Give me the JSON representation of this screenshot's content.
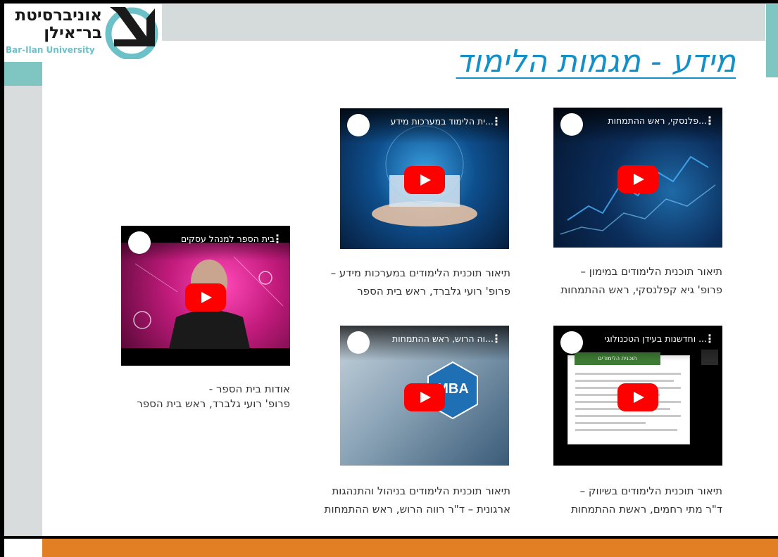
{
  "logo": {
    "hebrew_line1": "אוניברסיטת",
    "hebrew_line2": "בר־אילן",
    "english": "Bar-Ilan University"
  },
  "title": "מידע  -  מגמות הלימוד",
  "colors": {
    "title": "#1490c9",
    "top_bar": "#d5dadb",
    "teal": "#7fc6c3",
    "bottom_bar": "#e27f25",
    "play": "#ff0000"
  },
  "videos": [
    {
      "title": "...פלנסקי, ראש ההתמחות",
      "caption_line1": "תיאור תוכנית הלימודים במימון –",
      "caption_line2": "פרופ' גיא קפלנסקי,  ראש ההתמחות"
    },
    {
      "title": "...ית הלימוד במערכות מידע",
      "caption_line1": "תיאור תוכנית הלימודים במערכות מידע –",
      "caption_line2": "פרופ' רועי גלברד, ראש בית הספר"
    },
    {
      "title": "... וחדשנות בעידן הטכנולוגי",
      "caption_line1": "תיאור תוכנית הלימודים בשיווק –",
      "caption_line2": "ד\"ר מתי רחמים,  ראשת ההתמחות",
      "doc_header": "תוכנית הלימודים"
    },
    {
      "title": "...וה הרוש, ראש ההתמחות",
      "caption_line1": "תיאור תוכנית הלימודים בניהול והתנהגות",
      "caption_line2": "ארגונית – ד\"ר רווה הרוש, ראש ההתמחות",
      "badge": "MBA"
    },
    {
      "title": "בית הספר למנהל עסקים",
      "caption_line1": "אודות בית הספר -",
      "caption_line2": "פרופ' רועי גלברד, ראש בית הספר"
    }
  ]
}
